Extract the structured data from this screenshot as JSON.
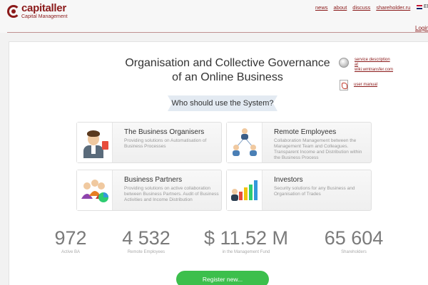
{
  "header": {
    "logo_name": "capitaller",
    "logo_sub": "Capital Management",
    "nav": [
      "news",
      "about",
      "discuss",
      "shareholder.ru"
    ],
    "lang": "EN",
    "login": "Login"
  },
  "main": {
    "title_line1": "Organisation and Collective Governance",
    "title_line2": "of an Online Business",
    "links": {
      "service": "service description at wiki.wmtransfer.com",
      "manual": "user manual"
    },
    "ribbon": "Who should use the System?",
    "cards": [
      {
        "title": "The Business Organisers",
        "desc": "Providing solutions on Automatisation of Business Processes"
      },
      {
        "title": "Remote Employees",
        "desc": "Collaboration Management between the Management Team and Colleagues. Transparent Income and Distribution within the Business Process"
      },
      {
        "title": "Business Partners",
        "desc": "Providing solutions on active collaboration between Business Partners. Audit of Business Activities and Income Distribution"
      },
      {
        "title": "Investors",
        "desc": "Security solutions for any Business and Organisation of Trades"
      }
    ],
    "stats": [
      {
        "value": "972",
        "label": "Active BA"
      },
      {
        "value": "4 532",
        "label": "Remote Employees"
      },
      {
        "value": "$ 11.52 M",
        "label": "in the Management Fund"
      },
      {
        "value": "65 604",
        "label": "Shareholders"
      }
    ],
    "register": "Register new..."
  },
  "colors": {
    "brand": "#8b1a1a",
    "accent": "#3cbf4c",
    "ribbon": "#e3eaf2"
  }
}
